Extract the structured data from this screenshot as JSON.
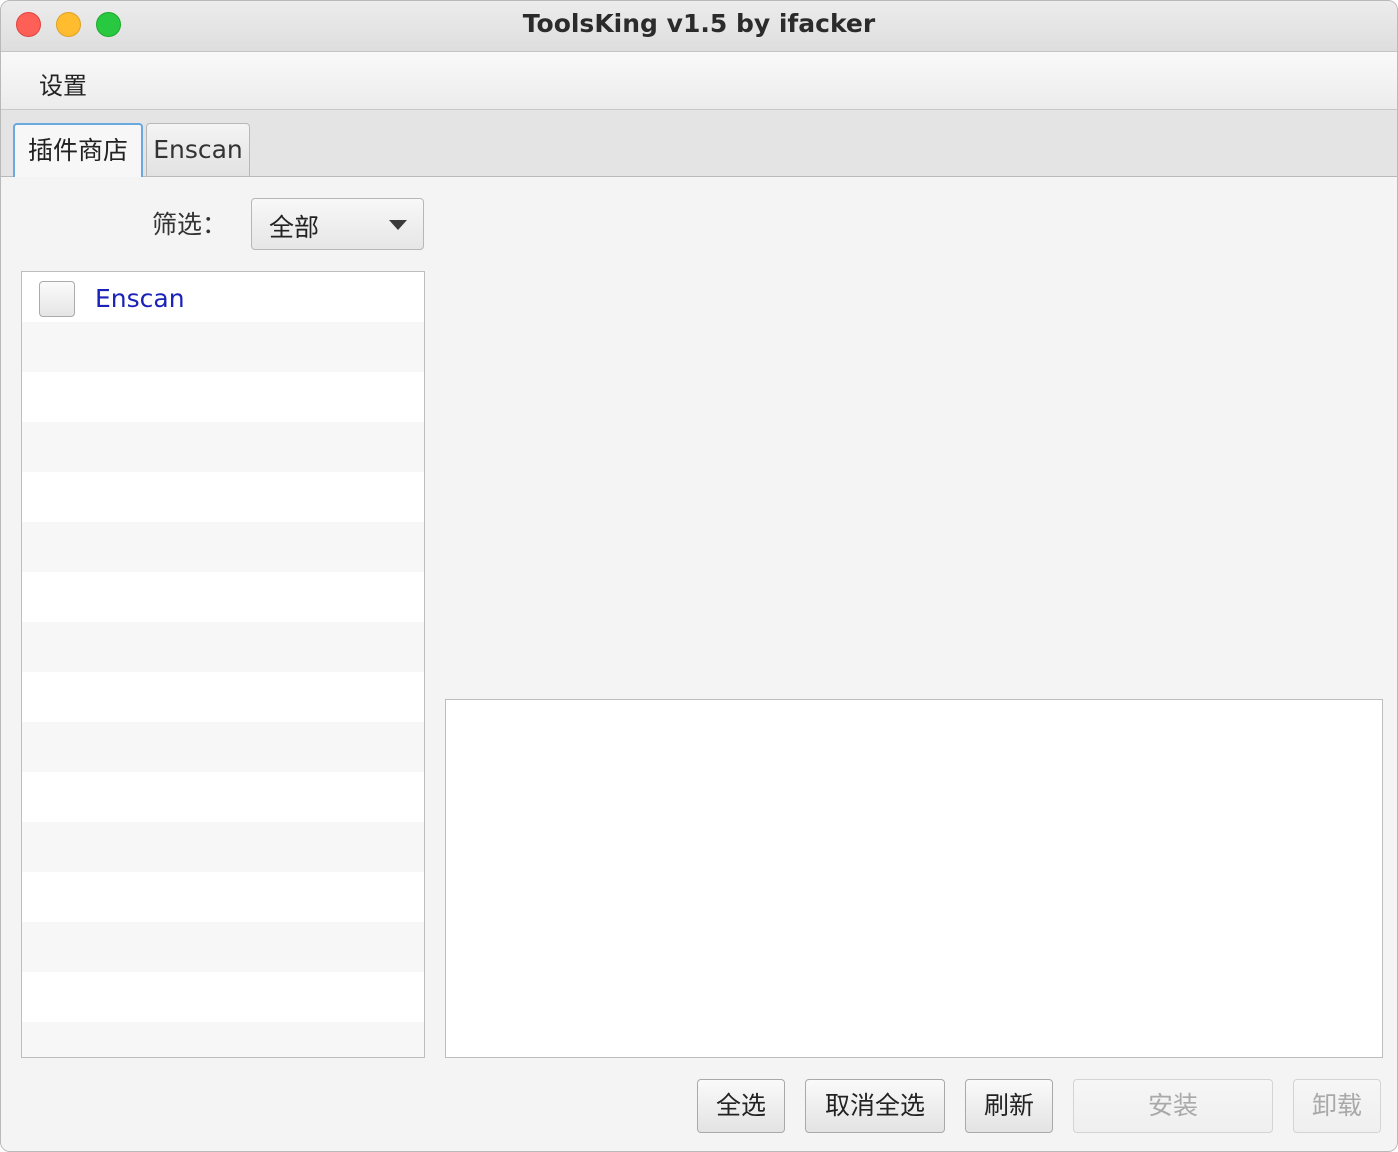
{
  "window": {
    "title": "ToolsKing v1.5 by ifacker"
  },
  "menubar": {
    "items": [
      {
        "label": "设置"
      }
    ]
  },
  "tabs": [
    {
      "label": "插件商店",
      "selected": true
    },
    {
      "label": "Enscan",
      "selected": false
    }
  ],
  "filter": {
    "label": "筛选：",
    "selected_value": "全部"
  },
  "plugins": [
    {
      "name": "Enscan",
      "checked": false
    }
  ],
  "buttons": {
    "select_all": "全选",
    "deselect_all": "取消全选",
    "refresh": "刷新",
    "install": "安装",
    "uninstall": "卸载"
  },
  "colors": {
    "plugin_name": "#1a22b8",
    "selected_tab_border": "#6aa9e0"
  }
}
